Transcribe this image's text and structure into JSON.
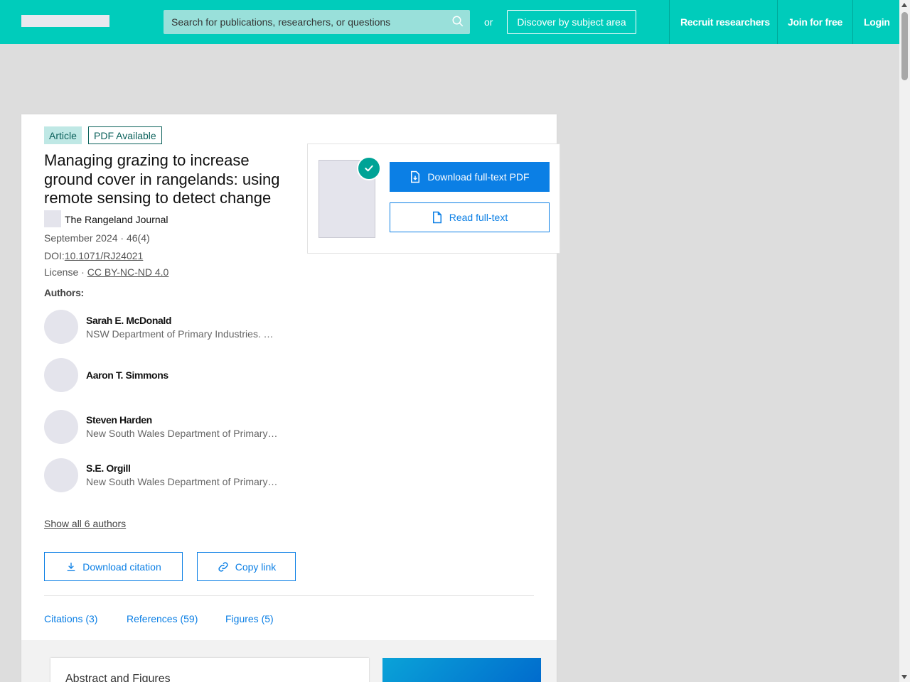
{
  "header": {
    "search_placeholder": "Search for publications, researchers, or questions",
    "or_text": "or",
    "discover_label": "Discover by subject area",
    "nav": {
      "recruit": "Recruit researchers",
      "join": "Join for free",
      "login": "Login"
    }
  },
  "article": {
    "type_badge": "Article",
    "pdf_badge": "PDF Available",
    "title": "Managing grazing to increase ground cover in rangelands: using remote sensing to detect change",
    "journal": "The Rangeland Journal",
    "date_issue": "September 2024 · 46(4)",
    "doi_prefix": "DOI:",
    "doi": "10.1071/RJ24021",
    "license_prefix": "License · ",
    "license": "CC BY-NC-ND 4.0",
    "authors_label": "Authors:",
    "authors": [
      {
        "name": "Sarah E. McDonald",
        "affiliation": "NSW Department of Primary Industries. Tr..."
      },
      {
        "name": "Aaron T. Simmons",
        "affiliation": ""
      },
      {
        "name": "Steven Harden",
        "affiliation": "New South Wales Department of Primary ..."
      },
      {
        "name": "S.E. Orgill",
        "affiliation": "New South Wales Department of Primary ..."
      }
    ],
    "show_all": "Show all 6 authors",
    "download_citation": "Download citation",
    "copy_link": "Copy link",
    "tabs": {
      "citations": "Citations (3)",
      "references": "References (59)",
      "figures": "Figures (5)"
    },
    "abstract_title": "Abstract and Figures"
  },
  "pdf_panel": {
    "download_label": "Download full-text PDF",
    "read_label": "Read full-text"
  },
  "colors": {
    "header_teal": "#00ccbb",
    "primary_blue": "#0b7fe5",
    "badge_teal": "#bfe8e5",
    "check_green": "#00a396"
  },
  "icons": [
    "search-icon",
    "check-icon",
    "pdf-download-icon",
    "document-icon",
    "download-icon",
    "link-icon"
  ]
}
